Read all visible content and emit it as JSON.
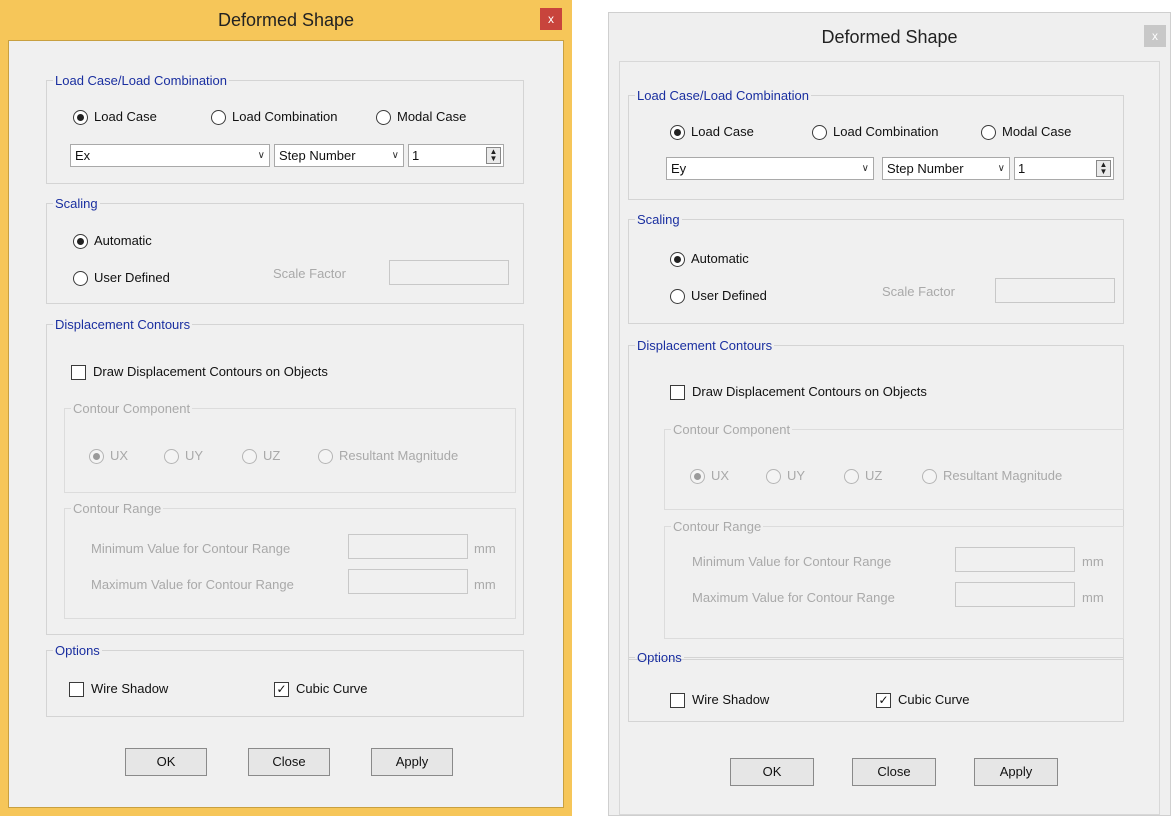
{
  "dialogs": [
    {
      "title": "Deformed Shape",
      "close_label": "x",
      "load_group": {
        "legend": "Load Case/Load Combination",
        "options": [
          "Load Case",
          "Load Combination",
          "Modal Case"
        ],
        "case_value": "Ex",
        "step_value": "Step Number",
        "step_number": "1"
      },
      "scaling": {
        "legend": "Scaling",
        "automatic": "Automatic",
        "user_defined": "User Defined",
        "scale_factor_label": "Scale Factor"
      },
      "contours": {
        "legend": "Displacement Contours",
        "draw_label": "Draw Displacement Contours on Objects",
        "component_legend": "Contour Component",
        "components": [
          "UX",
          "UY",
          "UZ",
          "Resultant Magnitude"
        ],
        "range_legend": "Contour Range",
        "min_label": "Minimum Value for Contour Range",
        "max_label": "Maximum Value for Contour Range",
        "unit": "mm"
      },
      "options": {
        "legend": "Options",
        "wire_shadow": "Wire Shadow",
        "cubic_curve": "Cubic Curve"
      },
      "buttons": {
        "ok": "OK",
        "close": "Close",
        "apply": "Apply"
      }
    },
    {
      "title": "Deformed Shape",
      "close_label": "x",
      "load_group": {
        "legend": "Load Case/Load Combination",
        "options": [
          "Load Case",
          "Load Combination",
          "Modal Case"
        ],
        "case_value": "Ey",
        "step_value": "Step Number",
        "step_number": "1"
      },
      "scaling": {
        "legend": "Scaling",
        "automatic": "Automatic",
        "user_defined": "User Defined",
        "scale_factor_label": "Scale Factor"
      },
      "contours": {
        "legend": "Displacement Contours",
        "draw_label": "Draw Displacement Contours on Objects",
        "component_legend": "Contour Component",
        "components": [
          "UX",
          "UY",
          "UZ",
          "Resultant Magnitude"
        ],
        "range_legend": "Contour Range",
        "min_label": "Minimum Value for Contour Range",
        "max_label": "Maximum Value for Contour Range",
        "unit": "mm"
      },
      "options": {
        "legend": "Options",
        "wire_shadow": "Wire Shadow",
        "cubic_curve": "Cubic Curve"
      },
      "buttons": {
        "ok": "OK",
        "close": "Close",
        "apply": "Apply"
      }
    }
  ],
  "colors": {
    "active_frame": "#f6c659",
    "inactive_frame": "#efefef",
    "close_active": "#c8443c",
    "group_legend": "#1a2fa0"
  },
  "icons": [
    "radio-icon",
    "checkbox-icon",
    "dropdown-arrow-icon",
    "spinner-icon",
    "close-icon"
  ]
}
